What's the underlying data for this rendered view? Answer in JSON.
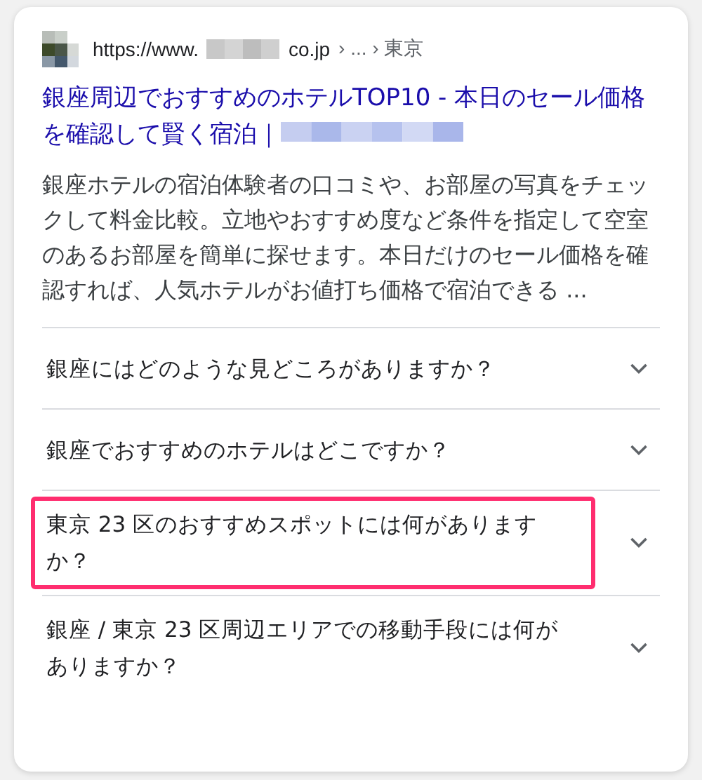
{
  "result": {
    "url_prefix": "https://www.",
    "url_suffix": "co.jp",
    "breadcrumb": "› ... › 東京",
    "title": "銀座周辺でおすすめのホテルTOP10 - 本日のセール価格を確認して賢く宿泊｜",
    "snippet": "銀座ホテルの宿泊体験者の口コミや、お部屋の写真をチェックして料金比較。立地やおすすめ度など条件を指定して空室のあるお部屋を簡単に探せます。本日だけのセール価格を確認すれば、人気ホテルがお値打ち価格で宿泊できる ..."
  },
  "questions": [
    {
      "text": "銀座にはどのような見どころがありますか？",
      "expanded": false,
      "highlighted": false
    },
    {
      "text": "銀座でおすすめのホテルはどこですか？",
      "expanded": false,
      "highlighted": false
    },
    {
      "text": "東京 23 区のおすすめスポットには何がありますか？",
      "expanded": false,
      "highlighted": true
    },
    {
      "text": "銀座 / 東京 23 区周辺エリアでの移動手段には何がありますか？",
      "expanded": false,
      "highlighted": false
    }
  ]
}
